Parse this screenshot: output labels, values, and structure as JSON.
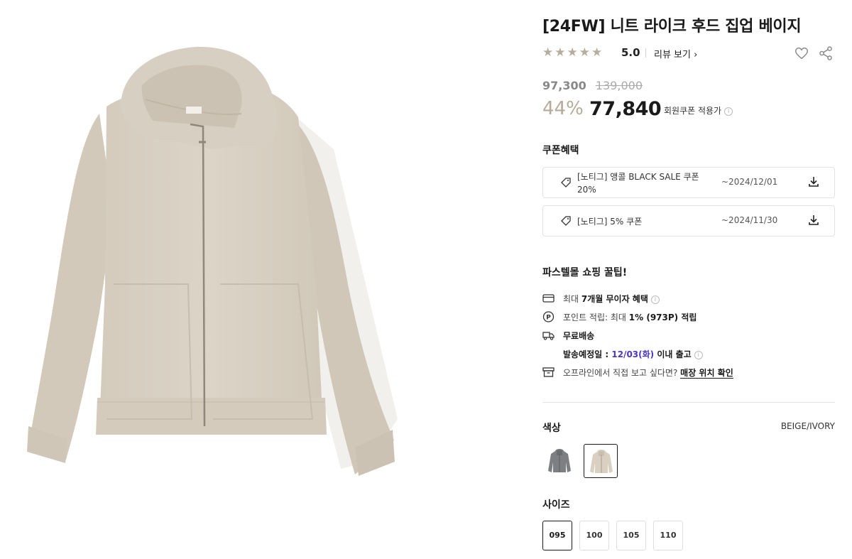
{
  "product": {
    "title": "[24FW] 니트 라이크 후드 집업 베이지",
    "image_icon": "hoodie-photo",
    "rating": {
      "stars": "★★★★★",
      "score": "5.0",
      "review_link": "리뷰 보기"
    },
    "price": {
      "original": "97,300",
      "list": "139,000",
      "discount": "44%",
      "sale": "77,840",
      "coupon_label": "회원쿠폰 적용가"
    }
  },
  "coupons": {
    "title": "쿠폰혜택",
    "items": [
      {
        "name": "[노티그] 앵콜 BLACK SALE 쿠폰 20%",
        "date": "~2024/12/01"
      },
      {
        "name": "[노티그] 5% 쿠폰",
        "date": "~2024/11/30"
      }
    ]
  },
  "tips": {
    "title": "파스텔몰 쇼핑 꿀팁!",
    "installment_prefix": "최대 ",
    "installment_bold": "7개월 무이자 혜택",
    "points_prefix": "포인트 적립: 최대 ",
    "points_bold": "1% (973P) 적립",
    "free_shipping": "무료배송",
    "ship_prefix": "발송예정일 : ",
    "ship_date": "12/03(화)",
    "ship_suffix": " 이내 출고",
    "store_prefix": "오프라인에서 직접 보고 싶다면? ",
    "store_link": "매장 위치 확인"
  },
  "color": {
    "label": "색상",
    "selected": "BEIGE/IVORY",
    "swatches": [
      {
        "name": "gray-hoodie",
        "color": "#7d7f83"
      },
      {
        "name": "beige-hoodie",
        "color": "#d9d0c2"
      }
    ]
  },
  "size": {
    "label": "사이즈",
    "options": [
      "095",
      "100",
      "105",
      "110"
    ],
    "selected": "095"
  },
  "colors": {
    "accent_star": "#b7ad9d",
    "discount": "#b6ab98",
    "ship_date": "#4b36c4",
    "hoodie": "#d9d0c2"
  }
}
